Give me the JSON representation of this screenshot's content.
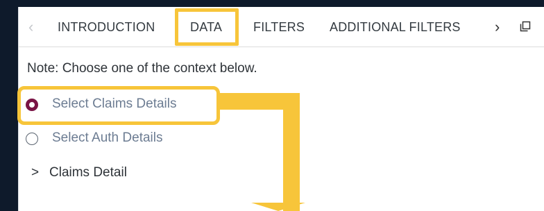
{
  "tabs": {
    "prev_glyph": "‹",
    "items": [
      "INTRODUCTION",
      "DATA",
      "FILTERS",
      "ADDITIONAL FILTERS"
    ],
    "next_glyph": "›",
    "active": "DATA",
    "icons": [
      "chevron-left-icon",
      "chevron-right-icon",
      "copy-icon"
    ]
  },
  "content": {
    "note": "Note: Choose one of the context below.",
    "options": [
      {
        "label": "Select Claims Details",
        "checked": true
      },
      {
        "label": "Select Auth Details",
        "checked": false
      }
    ],
    "accordion": {
      "chevron": ">",
      "label": "Claims Detail"
    }
  },
  "colors": {
    "highlight": "#f7c53a",
    "radio_checked": "#7a1445",
    "background": "#0e1a2b"
  }
}
